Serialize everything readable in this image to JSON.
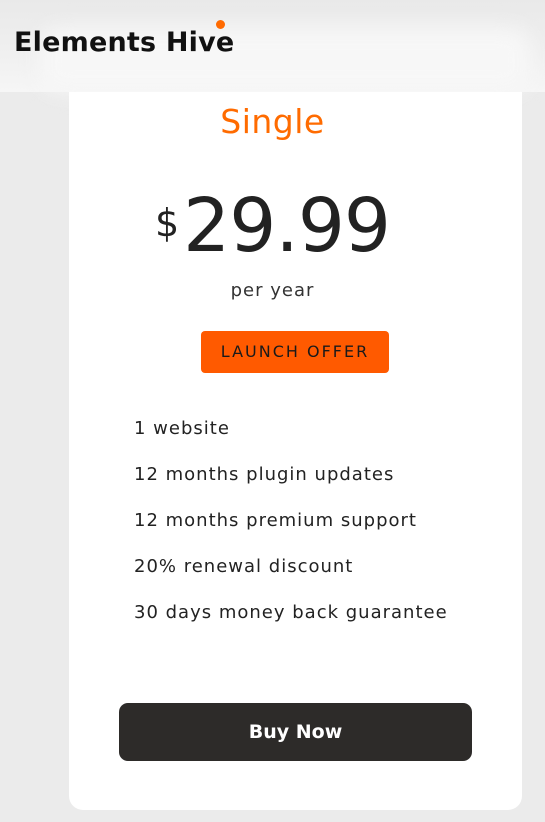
{
  "brand": {
    "name": "Elements Hive",
    "accent_color": "#ff6a00"
  },
  "plan": {
    "title": "Single",
    "currency": "$",
    "price": "29.99",
    "period": "per year",
    "badge": "LAUNCH OFFER",
    "features": [
      "1 website",
      "12 months plugin updates",
      "12 months premium support",
      "20% renewal discount",
      "30 days money back guarantee"
    ],
    "cta_label": "Buy Now"
  },
  "colors": {
    "title": "#ff6b00",
    "badge_bg": "#ff5a00",
    "button_bg": "#2d2b29",
    "card_bg": "#ffffff",
    "page_bg": "#ebebeb"
  }
}
